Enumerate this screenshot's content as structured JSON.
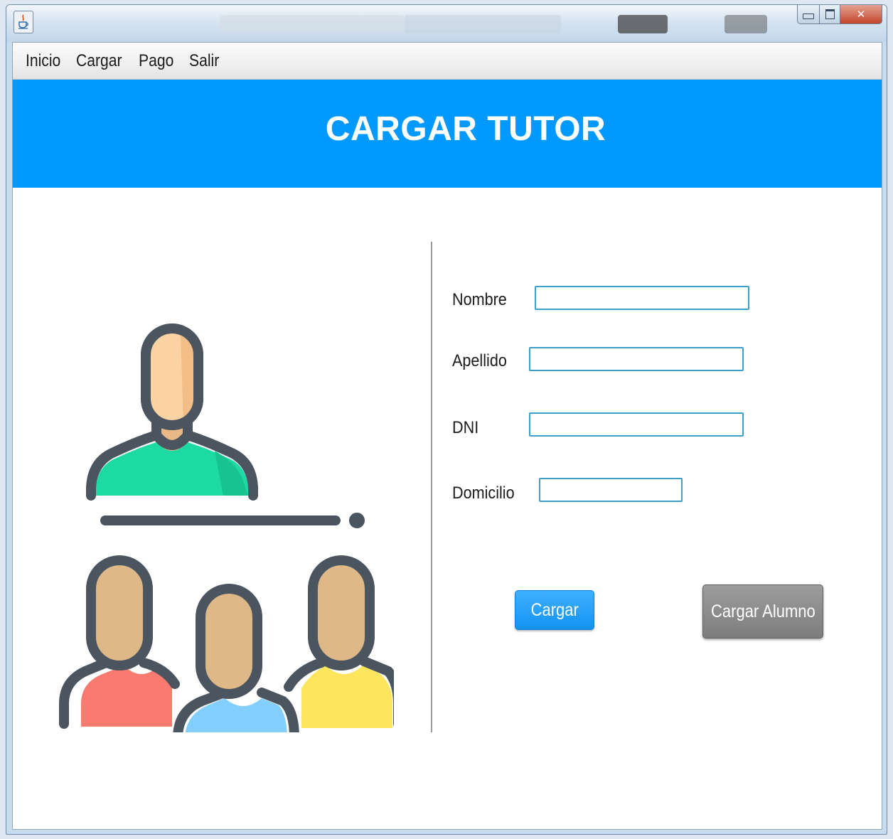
{
  "window": {
    "icon": "java-coffee-cup-icon",
    "controls": [
      "minimize-icon",
      "maximize-icon",
      "close-icon"
    ]
  },
  "menu": {
    "items": [
      "Inicio",
      "Cargar",
      "Pago",
      "Salir"
    ]
  },
  "header": {
    "title": "CARGAR TUTOR",
    "background": "#0099ff"
  },
  "illustration": {
    "icon": "tutor-and-students-icon",
    "colors": {
      "outline": "#4a5560",
      "skin": "#fbd3a2",
      "skin_shade": "#e8b987",
      "skin_students": "#deb887",
      "tutor_shirt": "#1dd9a2",
      "student_left_shirt": "#f97a6f",
      "student_center_shirt": "#82cfff",
      "student_right_shirt": "#fde55d"
    }
  },
  "form": {
    "fields": [
      {
        "label": "Nombre",
        "value": ""
      },
      {
        "label": "Apellido",
        "value": ""
      },
      {
        "label": "DNI",
        "value": ""
      },
      {
        "label": "Domicilio",
        "value": ""
      }
    ],
    "primary_button": "Cargar",
    "secondary_button": "Cargar Alumno",
    "input_border_color": "#3ba0c9",
    "primary_color": "#1a9bf5",
    "secondary_color": "#8a8a8a"
  }
}
